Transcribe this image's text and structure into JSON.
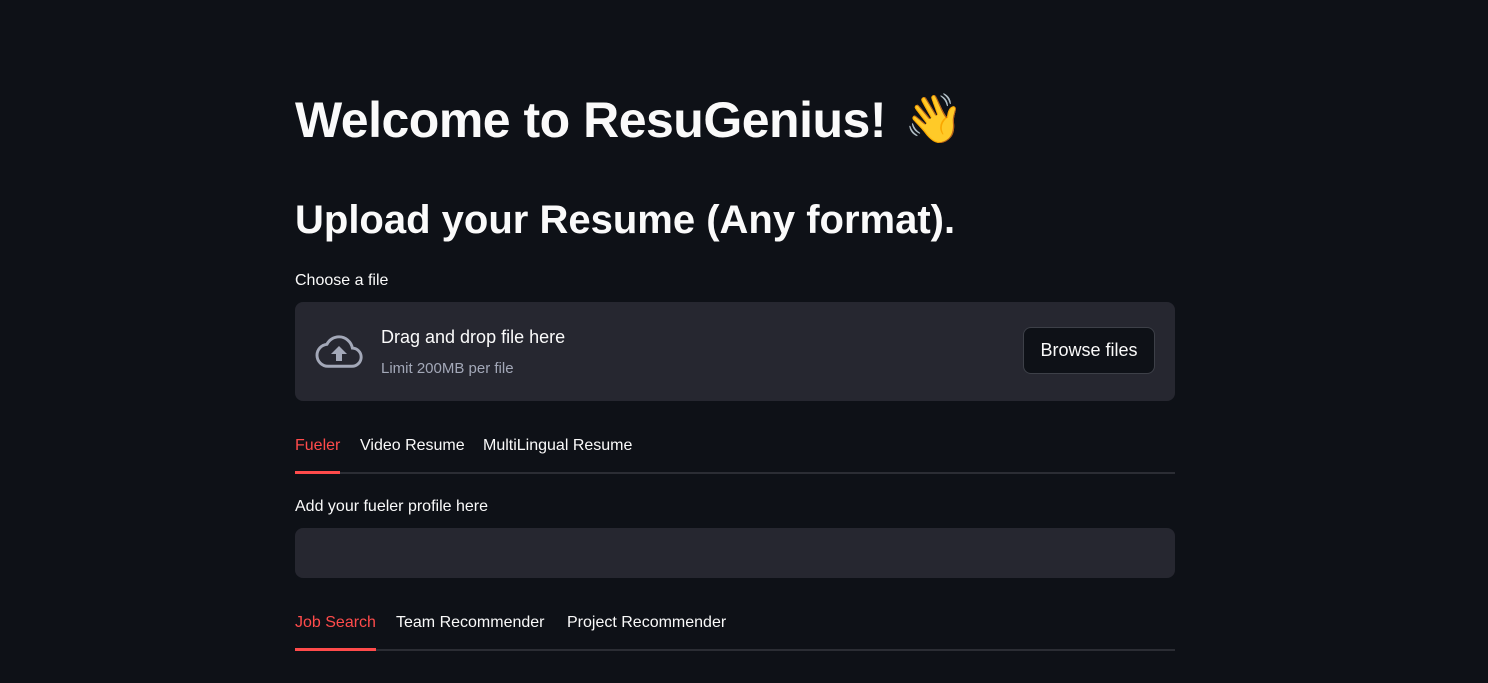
{
  "header": {
    "title": "Welcome to ResuGenius!",
    "title_emoji": "👋",
    "subtitle": "Upload your Resume (Any format)."
  },
  "uploader": {
    "label": "Choose a file",
    "drag_text": "Drag and drop file here",
    "limit_text": "Limit 200MB per file",
    "browse_label": "Browse files",
    "icon": "cloud-upload-icon"
  },
  "tabs_primary": [
    {
      "label": "Fueler",
      "active": true
    },
    {
      "label": "Video Resume",
      "active": false
    },
    {
      "label": "MultiLingual Resume",
      "active": false
    }
  ],
  "fueler": {
    "input_label": "Add your fueler profile here",
    "input_value": "",
    "input_placeholder": ""
  },
  "tabs_secondary": [
    {
      "label": "Job Search",
      "active": true
    },
    {
      "label": "Team Recommender",
      "active": false
    },
    {
      "label": "Project Recommender",
      "active": false
    }
  ],
  "colors": {
    "background": "#0e1117",
    "surface": "#262730",
    "text": "#fafafa",
    "muted_text": "#a3a8b8",
    "accent": "#ff4b4b"
  }
}
